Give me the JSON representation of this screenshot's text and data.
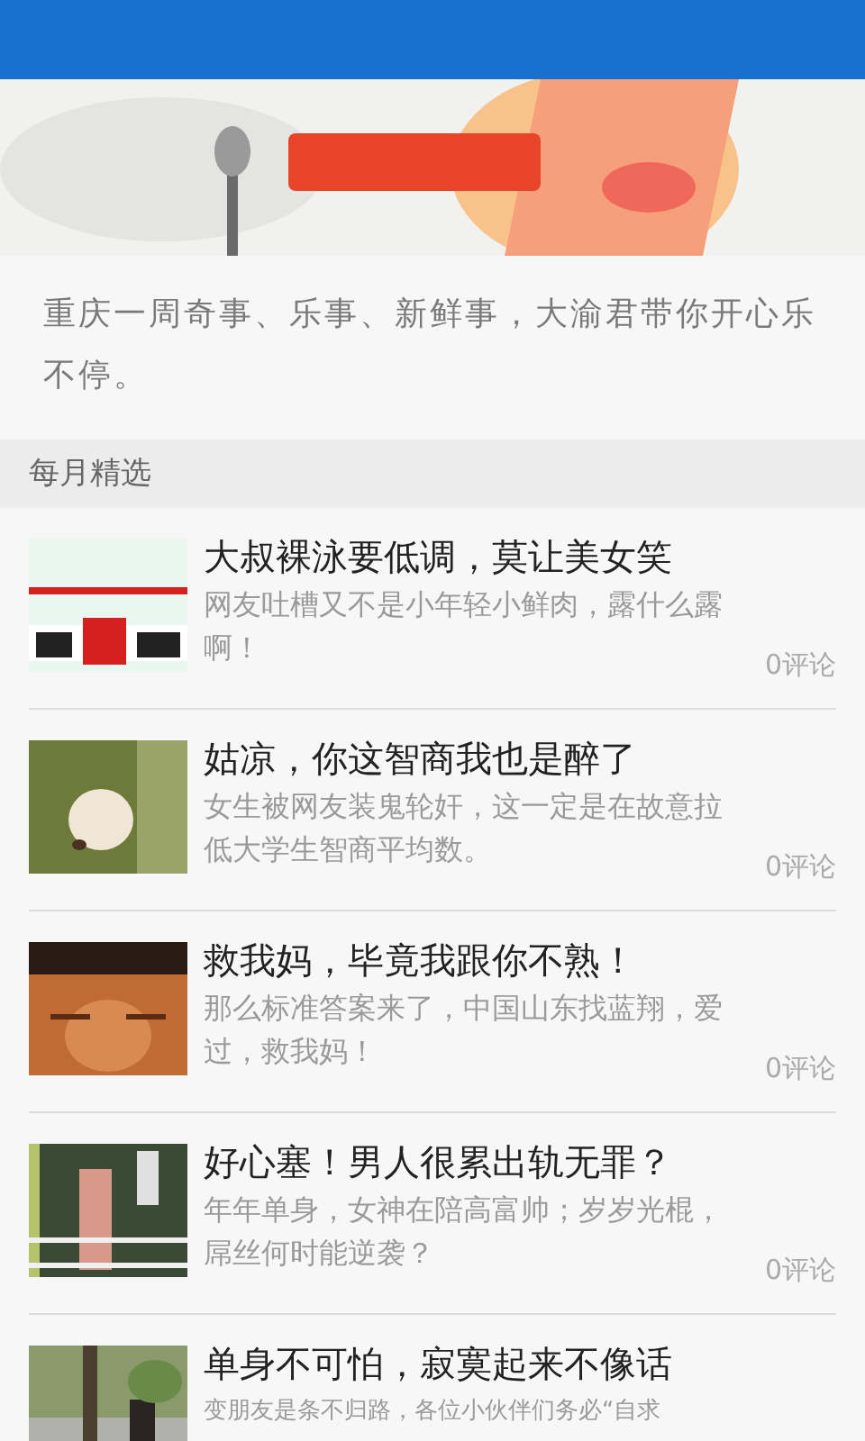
{
  "intro": "重庆一周奇事、乐事、新鲜事，大渝君带你开心乐不停。",
  "section": {
    "title": "每月精选"
  },
  "articles": [
    {
      "title": "大叔裸泳要低调，莫让美女笑",
      "summary": "网友吐槽又不是小年轻小鲜肉，露什么露啊！",
      "comments": "0评论"
    },
    {
      "title": "姑凉，你这智商我也是醉了",
      "summary": "女生被网友装鬼轮奸，这一定是在故意拉低大学生智商平均数。",
      "comments": "0评论"
    },
    {
      "title": "救我妈，毕竟我跟你不熟！",
      "summary": "那么标准答案来了，中国山东找蓝翔，爱过，救我妈！",
      "comments": "0评论"
    },
    {
      "title": "好心塞！男人很累出轨无罪？",
      "summary": "年年单身，女神在陪高富帅；岁岁光棍，屌丝何时能逆袭？",
      "comments": "0评论"
    },
    {
      "title": "单身不可怕，寂寞起来不像话",
      "summary": "变朋友是条不归路，各位小伙伴们务必“自求"
    }
  ]
}
